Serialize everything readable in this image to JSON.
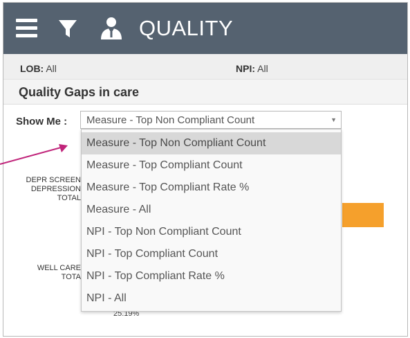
{
  "header": {
    "title": "QUALITY",
    "bg_color": "#556270",
    "icons": [
      "hamburger-menu-icon",
      "filter-icon",
      "person-icon"
    ]
  },
  "filters": {
    "lob_label": "LOB:",
    "lob_value": "All",
    "npi_label": "NPI:",
    "npi_value": "All"
  },
  "section": {
    "title": "Quality Gaps in care"
  },
  "show_me": {
    "label": "Show Me :",
    "selected": "Measure - Top Non Compliant Count",
    "options": [
      "Measure - Top Non Compliant Count",
      "Measure - Top Compliant Count",
      "Measure - Top Compliant Rate %",
      "Measure - All",
      "NPI - Top Non Compliant Count",
      "NPI - Top Compliant Count",
      "NPI - Top Compliant Rate %",
      "NPI - All"
    ]
  },
  "chart_background": {
    "label_1": [
      "DEPR SCREEN",
      "DEPRESSION",
      "TOTAL"
    ],
    "label_2": [
      "WELL CARE",
      "TOTA"
    ],
    "pct": "25.19%",
    "accent_color": "#f5a02c"
  },
  "annotation": {
    "arrow_color": "#c0247a"
  }
}
